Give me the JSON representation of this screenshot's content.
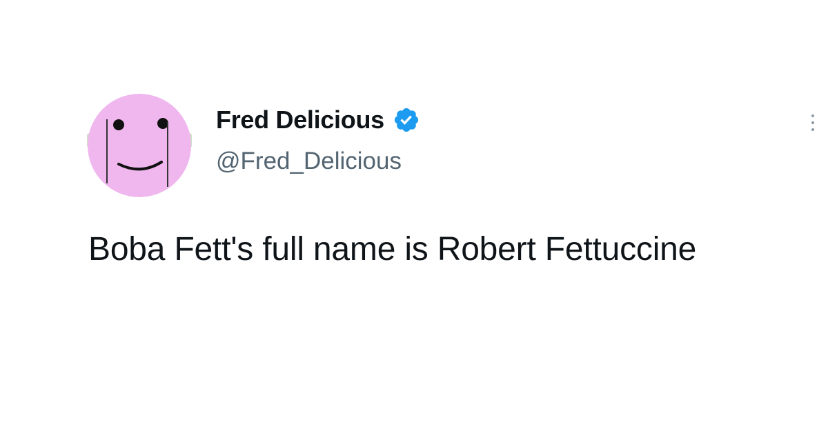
{
  "tweet": {
    "author": {
      "display_name": "Fred Delicious",
      "handle": "@Fred_Delicious",
      "verified": true,
      "avatar_icon": "smiley-face-avatar",
      "avatar_color": "#f0b7ee"
    },
    "text": "Boba Fett's full name is Robert Fettuccine",
    "more_icon": "more-options-icon"
  },
  "colors": {
    "verified_badge": "#1d9bf0",
    "handle_text": "#536471",
    "primary_text": "#0f1419"
  }
}
